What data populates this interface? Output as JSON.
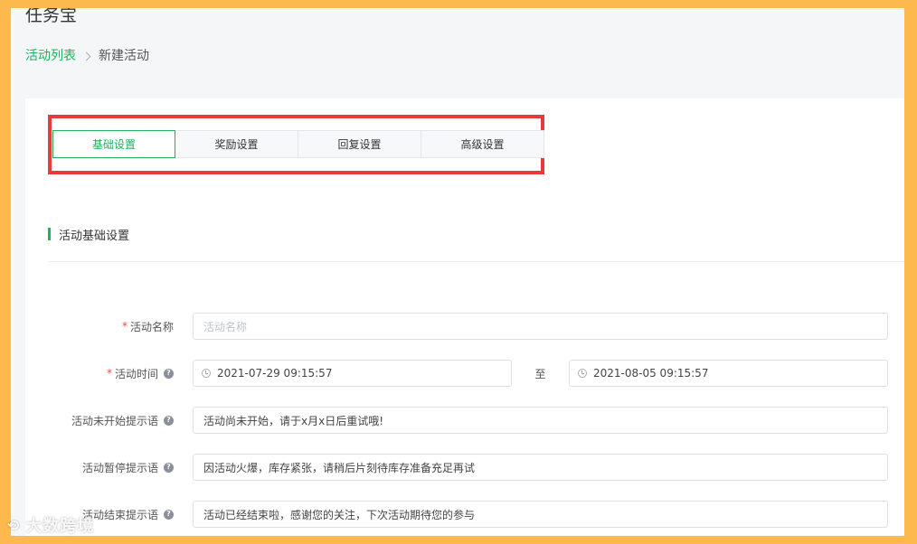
{
  "app": {
    "title": "任务宝"
  },
  "breadcrumb": {
    "parent": "活动列表",
    "current": "新建活动"
  },
  "tabs": [
    {
      "label": "基础设置",
      "active": true
    },
    {
      "label": "奖励设置",
      "active": false
    },
    {
      "label": "回复设置",
      "active": false
    },
    {
      "label": "高级设置",
      "active": false
    }
  ],
  "section": {
    "title": "活动基础设置"
  },
  "form": {
    "name": {
      "label": "活动名称",
      "placeholder": "活动名称",
      "value": ""
    },
    "time": {
      "label": "活动时间",
      "start": "2021-07-29 09:15:57",
      "separator": "至",
      "end": "2021-08-05 09:15:57"
    },
    "not_started_tip": {
      "label": "活动未开始提示语",
      "value": "活动尚未开始，请于x月x日后重试哦!"
    },
    "paused_tip": {
      "label": "活动暂停提示语",
      "value": "因活动火爆，库存紧张，请稍后片刻待库存准备充足再试"
    },
    "ended_tip": {
      "label": "活动结束提示语",
      "value": "活动已经结束啦，感谢您的关注，下次活动期待您的参与"
    }
  },
  "watermark": {
    "text": "大数跨境"
  },
  "colors": {
    "accent": "#1fb25c",
    "highlight": "#e83a3a",
    "frame": "#fdb94e",
    "required": "#e84c3d"
  }
}
